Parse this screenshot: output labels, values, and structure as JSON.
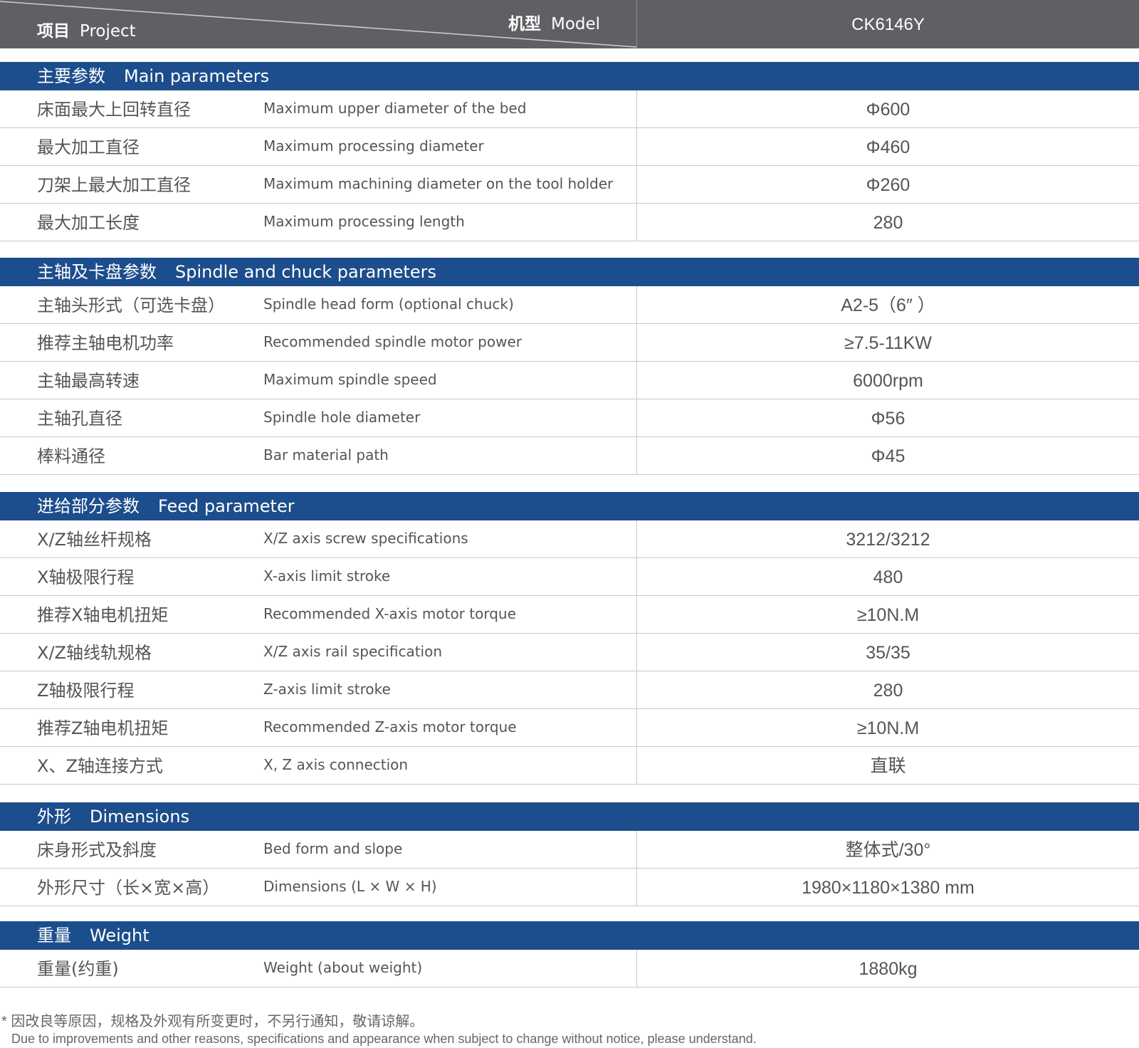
{
  "header": {
    "project_zh": "项目",
    "project_en": "Project",
    "model_zh": "机型",
    "model_en": "Model",
    "model_value": "CK6146Y"
  },
  "sections": [
    {
      "title_zh": "主要参数",
      "title_en": "Main parameters",
      "rows": [
        {
          "zh": "床面最大上回转直径",
          "en": "Maximum upper diameter of the bed",
          "value": "Φ600"
        },
        {
          "zh": "最大加工直径",
          "en": "Maximum processing diameter",
          "value": "Φ460"
        },
        {
          "zh": "刀架上最大加工直径",
          "en": "Maximum machining diameter on the tool holder",
          "value": "Φ260"
        },
        {
          "zh": "最大加工长度",
          "en": "Maximum processing length",
          "value": "280"
        }
      ]
    },
    {
      "title_zh": "主轴及卡盘参数",
      "title_en": "Spindle and chuck parameters",
      "rows": [
        {
          "zh": "主轴头形式（可选卡盘）",
          "en": "Spindle head form (optional chuck)",
          "value": "A2-5（6″ ）"
        },
        {
          "zh": "推荐主轴电机功率",
          "en": "Recommended spindle motor power",
          "value": "≥7.5-11KW"
        },
        {
          "zh": "主轴最高转速",
          "en": "Maximum spindle speed",
          "value": "6000rpm"
        },
        {
          "zh": "主轴孔直径",
          "en": "Spindle hole diameter",
          "value": "Φ56"
        },
        {
          "zh": "棒料通径",
          "en": "Bar material path",
          "value": "Φ45"
        }
      ]
    },
    {
      "title_zh": "进给部分参数",
      "title_en": "Feed parameter",
      "rows": [
        {
          "zh": "X/Z轴丝杆规格",
          "en": "X/Z axis screw specifications",
          "value": "3212/3212"
        },
        {
          "zh": "X轴极限行程",
          "en": "X-axis limit stroke",
          "value": "480"
        },
        {
          "zh": "推荐X轴电机扭矩",
          "en": "Recommended X-axis motor torque",
          "value": "≥10N.M"
        },
        {
          "zh": "X/Z轴线轨规格",
          "en": "X/Z axis rail specification",
          "value": "35/35"
        },
        {
          "zh": "Z轴极限行程",
          "en": "Z-axis limit stroke",
          "value": "280"
        },
        {
          "zh": "推荐Z轴电机扭矩",
          "en": "Recommended Z-axis motor torque",
          "value": "≥10N.M"
        },
        {
          "zh": "X、Z轴连接方式",
          "en": "X, Z axis connection",
          "value": "直联"
        }
      ]
    },
    {
      "title_zh": "外形",
      "title_en": "Dimensions",
      "rows": [
        {
          "zh": "床身形式及斜度",
          "en": "Bed form and slope",
          "value": "整体式/30°"
        },
        {
          "zh": "外形尺寸（长×宽×高）",
          "en": "Dimensions (L × W × H)",
          "value": "1980×1180×1380 mm"
        }
      ]
    },
    {
      "title_zh": "重量",
      "title_en": "Weight",
      "rows": [
        {
          "zh": "重量(约重)",
          "en": "Weight (about weight)",
          "value": "1880kg"
        }
      ]
    }
  ],
  "notes": {
    "zh": "* 因改良等原因，规格及外观有所变更时，不另行通知，敬请谅解。",
    "en": "Due to improvements and other reasons, specifications and appearance when subject to change without notice, please understand."
  },
  "colors": {
    "header_bg": "#5f6064",
    "section_bg": "#1c4d8c",
    "text": "#555555",
    "rule": "#c9c9c9"
  }
}
